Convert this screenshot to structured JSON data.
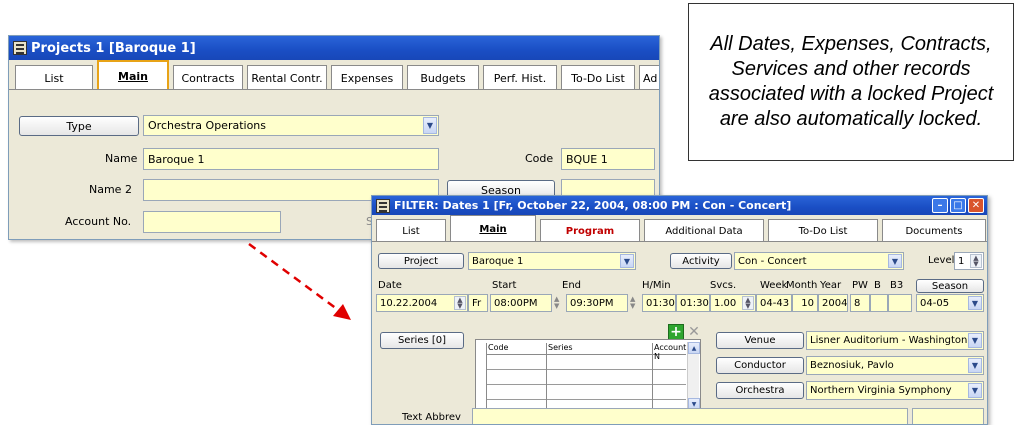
{
  "note": {
    "text": "All Dates, Expenses, Contracts, Services and other records associated with a locked Project are also automatically locked."
  },
  "project_window": {
    "title": "Projects  1 [Baroque 1]",
    "tabs": [
      "List",
      "Main",
      "Contracts",
      "Rental Contr.",
      "Expenses",
      "Budgets",
      "Perf. Hist.",
      "To-Do List",
      "Ad"
    ],
    "type_button": "Type",
    "type_value": "Orchestra Operations",
    "name_label": "Name",
    "name_value": "Baroque 1",
    "code_label": "Code",
    "code_value": "BQUE 1",
    "name2_label": "Name 2",
    "name2_value": "",
    "season_button": "Season",
    "season_value": "",
    "account_label": "Account No.",
    "account_value": "",
    "peek_char": "S"
  },
  "dates_window": {
    "title": "FILTER: Dates  1 [Fr, October  22, 2004, 08:00 PM : Con - Concert]",
    "tabs": [
      "List",
      "Main",
      "Program",
      "Additional Data",
      "To-Do List",
      "Documents"
    ],
    "project_button": "Project",
    "project_value": "Baroque 1",
    "activity_button": "Activity",
    "activity_value": "Con - Concert",
    "level_label": "Level",
    "level_value": "1",
    "headers": {
      "date": "Date",
      "start": "Start",
      "end": "End",
      "hmin": "H/Min",
      "svcs": "Svcs.",
      "week": "Week",
      "month": "Month",
      "year": "Year",
      "pw": "PW",
      "b": "B",
      "b3": "B3"
    },
    "values": {
      "date": "10.22.2004",
      "day": "Fr",
      "start": "08:00PM",
      "end": "09:30PM",
      "hmin1": "01:30",
      "hmin2": "01:30",
      "svcs": "1.00",
      "week": "04-43",
      "month": "10",
      "year": "2004",
      "pw": "8",
      "b": "",
      "b3": ""
    },
    "season_button": "Season",
    "season_value": "04-05",
    "series_button": "Series [0]",
    "grid_headers": [
      "Code",
      "Series",
      "Account N"
    ],
    "venue_button": "Venue",
    "venue_value": "Lisner Auditorium - Washington",
    "conductor_button": "Conductor",
    "conductor_value": "Beznosiuk, Pavlo",
    "orchestra_button": "Orchestra",
    "orchestra_value": "Northern Virginia Symphony",
    "text_abbrev_label": "Text Abbrev"
  },
  "colors": {
    "titlebar": "#1a4ec4",
    "field_fill": "#ffffcc",
    "window_bg": "#ece9d8",
    "arrow": "#e00000",
    "close_button": "#d9542c"
  }
}
